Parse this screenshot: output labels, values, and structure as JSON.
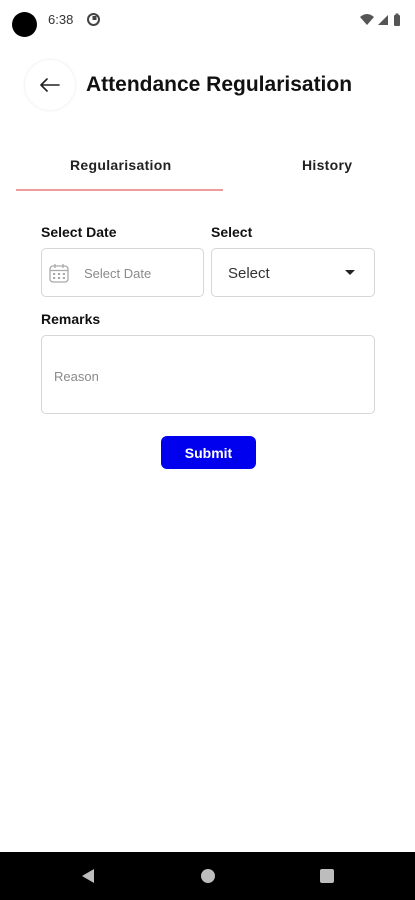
{
  "status_bar": {
    "time": "6:38",
    "icons": [
      "camera-cutout",
      "app-notification-icon",
      "wifi-icon",
      "signal-icon",
      "battery-icon"
    ]
  },
  "header": {
    "back_icon": "arrow-left-icon",
    "title": "Attendance Regularisation"
  },
  "tabs": [
    {
      "label": "Regularisation",
      "active": true
    },
    {
      "label": "History",
      "active": false
    }
  ],
  "form": {
    "date_label": "Select Date",
    "date_placeholder": "Select Date",
    "date_icon": "calendar-icon",
    "select_label": "Select",
    "select_value": "Select",
    "remarks_label": "Remarks",
    "remarks_placeholder": "Reason",
    "submit_label": "Submit"
  },
  "nav_bar": {
    "icons": [
      "back-triangle-icon",
      "home-circle-icon",
      "recents-square-icon"
    ]
  },
  "colors": {
    "accent_submit": "#0000ee",
    "tab_indicator": "#f29b9b",
    "nav_bar": "#000000"
  }
}
